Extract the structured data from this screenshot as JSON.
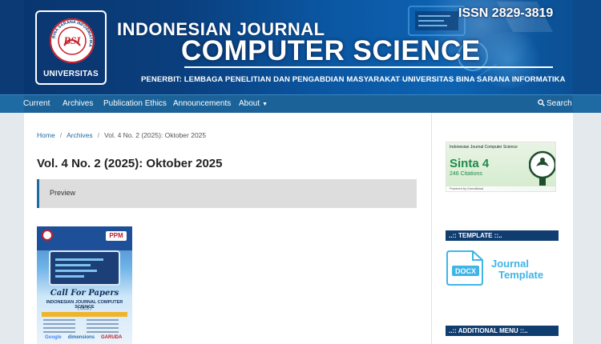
{
  "header": {
    "issn": "ISSN 2829-3819",
    "title_line1": "INDONESIAN JOURNAL",
    "title_line2": "COMPUTER SCIENCE",
    "publisher": "PENERBIT: LEMBAGA PENELITIAN DAN PENGABDIAN MASYARAKAT UNIVERSITAS BINA SARANA INFORMATIKA",
    "logo_caption": "UNIVERSITAS",
    "logo_ring_text": "BINA SARANA INFORMATIKA",
    "logo_mark": "BSI"
  },
  "nav": {
    "items": [
      "Current",
      "Archives",
      "Publication Ethics",
      "Announcements",
      "About"
    ],
    "search_label": "Search"
  },
  "breadcrumb": {
    "home": "Home",
    "archives": "Archives",
    "current": "Vol. 4 No. 2 (2025): Oktober 2025"
  },
  "issue": {
    "title": "Vol. 4 No. 2 (2025): Oktober 2025",
    "preview_label": "Preview"
  },
  "cover": {
    "ppm": "PPM",
    "call": "Call For Papers",
    "journal_name": "INDONESIAN JOURNAL COMPUTER SCIENCE",
    "abbrev": "( IJCS )",
    "indexers": [
      "Google",
      "dimensions",
      "GARUDA"
    ]
  },
  "sidebar": {
    "sinta": {
      "journal": "Indonesian Journal Computer Science",
      "rank": "Sinta 4",
      "citations": "246 Citations",
      "powered": "Powered by Kemdikbud"
    },
    "template_heading": "..:: TEMPLATE ::..",
    "docx_label": "DOCX",
    "template_line1": "Journal",
    "template_line2": "Template",
    "additional_heading": "..:: ADDITIONAL MENU ::.."
  },
  "colors": {
    "header_bg": "#0b4a8f",
    "nav_bg": "#1b6299",
    "accent": "#1e6aa3",
    "sidebar_heading_bg": "#103d70",
    "sinta_green": "#1f8a4c",
    "template_cyan": "#3fb6e6"
  }
}
